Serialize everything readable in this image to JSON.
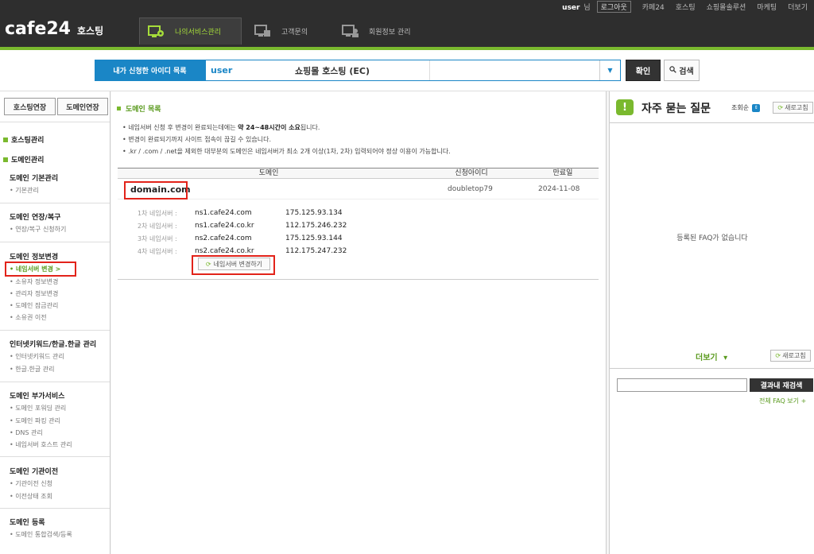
{
  "header": {
    "username": "user",
    "username_suffix": "님",
    "top_links": [
      "로그아웃",
      "카페24",
      "호스팅",
      "쇼핑몰솔루션",
      "마케팅",
      "더보기"
    ],
    "logo": "cafe24",
    "logo_sub": "호스팅",
    "tabs": [
      {
        "label": "나의서비스관리",
        "active": true
      },
      {
        "label": "고객문의",
        "active": false
      },
      {
        "label": "회원정보 관리",
        "active": false
      }
    ],
    "accent_color": "#7ab92e"
  },
  "idbar": {
    "label": "내가 신청한 아이디 목록",
    "user_id": "user",
    "plan": "쇼핑몰 호스팅 (EC)",
    "confirm_label": "확인",
    "search_label": "검색"
  },
  "sidebar": {
    "renew_hosting": "호스팅연장",
    "renew_domain": "도메인연장",
    "categories": [
      "호스팅관리",
      "도메인관리"
    ],
    "groups": [
      {
        "title": "도메인 기본관리",
        "items": [
          "기본관리"
        ]
      },
      {
        "title": "도메인 연장/복구",
        "items": [
          "연장/복구 신청하기"
        ]
      },
      {
        "title": "도메인 정보변경",
        "items": [
          "네임서버 변경 >",
          "소유자 정보변경",
          "관리자 정보변경",
          "도메인 잠금관리",
          "소유권 이전"
        ]
      },
      {
        "title": "인터넷키워드/한글.한글 관리",
        "items": [
          "인터넷키워드 관리",
          "한글.한글 관리"
        ]
      },
      {
        "title": "도메인 부가서비스",
        "items": [
          "도메인 포워딩 관리",
          "도메인 파킹 관리",
          "DNS 관리",
          "네임서버 호스트 관리"
        ]
      },
      {
        "title": "도메인 기관이전",
        "items": [
          "기관이전 신청",
          "이전상태 조회"
        ]
      },
      {
        "title": "도메인 등록",
        "items": [
          "도메인 통합검색/등록"
        ]
      }
    ]
  },
  "main": {
    "title": "도메인 목록",
    "notes": [
      {
        "pre": "네임서버 신청 후 변경이 완료되는데에는 ",
        "bold": "약 24~48시간이 소요",
        "post": "됩니다."
      },
      {
        "pre": "변경이 완료되기까지 사이트 접속이 끊길 수 있습니다.",
        "bold": "",
        "post": ""
      },
      {
        "pre": ".kr / .com / .net을 제외한 대부분의 도메인은 네임서버가 최소 2개 이상(1차, 2차) 입력되어야 정상 이용이 가능합니다.",
        "bold": "",
        "post": ""
      }
    ],
    "table": {
      "headers": [
        "도메인",
        "신청아이디",
        "만료일"
      ],
      "row": {
        "domain": "domain.com",
        "applicant": "doubletop79",
        "expires": "2024-11-08"
      }
    },
    "nameservers": [
      {
        "label": "1차 네임서버 :",
        "host": "ns1.cafe24.com",
        "ip": "175.125.93.134"
      },
      {
        "label": "2차 네임서버 :",
        "host": "ns1.cafe24.co.kr",
        "ip": "112.175.246.232"
      },
      {
        "label": "3차 네임서버 :",
        "host": "ns2.cafe24.com",
        "ip": "175.125.93.144"
      },
      {
        "label": "4차 네임서버 :",
        "host": "ns2.cafe24.co.kr",
        "ip": "112.175.247.232"
      }
    ],
    "change_ns_button": "네임서버 변경하기"
  },
  "faq": {
    "title": "자주 묻는 질문",
    "sort_label": "조회순",
    "refresh_label": "새로고침",
    "empty_text": "등록된 FAQ가 없습니다",
    "more_label": "더보기",
    "search_button": "결과내 재검색",
    "all_link": "전체 FAQ 보기 +"
  }
}
